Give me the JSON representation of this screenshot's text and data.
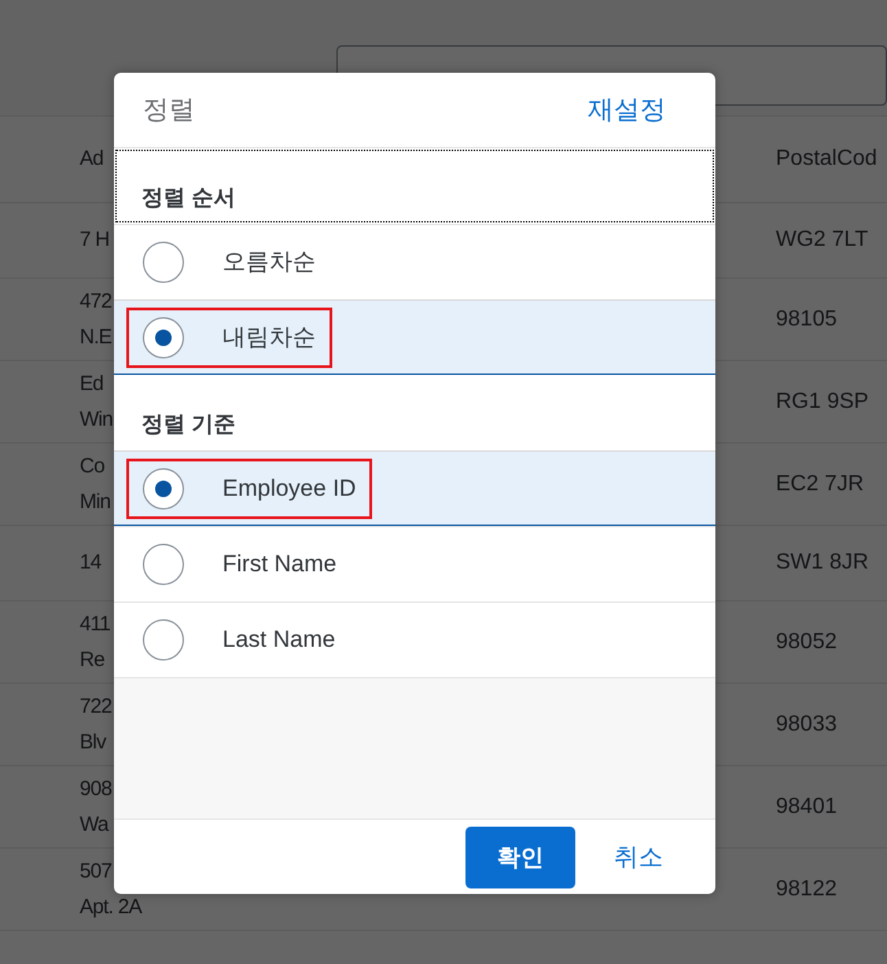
{
  "search": {
    "kind": "empty"
  },
  "table": {
    "columns": [
      "Ad",
      "PostalCod"
    ],
    "rows": [
      {
        "column_1": [
          "7 H"
        ],
        "postal_code": "WG2 7LT"
      },
      {
        "column_1": [
          "472",
          "N.E"
        ],
        "postal_code": "98105"
      },
      {
        "column_1": [
          "Ed",
          "Win"
        ],
        "postal_code": "RG1 9SP"
      },
      {
        "column_1": [
          "Co",
          "Min"
        ],
        "postal_code": "EC2 7JR"
      },
      {
        "column_1": [
          "14"
        ],
        "postal_code": "SW1 8JR"
      },
      {
        "column_1": [
          "411",
          "Re"
        ],
        "postal_code": "98052"
      },
      {
        "column_1": [
          "722",
          "Blv"
        ],
        "postal_code": "98033"
      },
      {
        "column_1": [
          "908",
          "Wa"
        ],
        "postal_code": "98401"
      },
      {
        "column_1": [
          "507",
          "Apt. 2A"
        ],
        "postal_code": "98122"
      }
    ]
  },
  "dialog": {
    "title": "정렬",
    "reset": "재설정",
    "sections": [
      {
        "title": "정렬 순서",
        "focused": true,
        "items": [
          {
            "label": "오름차순",
            "selected": false,
            "highlighted": false
          },
          {
            "label": "내림차순",
            "selected": true,
            "highlighted": true
          }
        ]
      },
      {
        "title": "정렬 기준",
        "focused": false,
        "items": [
          {
            "label": "Employee ID",
            "selected": true,
            "highlighted": true
          },
          {
            "label": "First Name",
            "selected": false,
            "highlighted": false
          },
          {
            "label": "Last Name",
            "selected": false,
            "highlighted": false
          }
        ]
      }
    ],
    "buttons": [
      {
        "label": "확인",
        "kind": "primary"
      },
      {
        "label": "취소",
        "kind": "link"
      }
    ]
  }
}
